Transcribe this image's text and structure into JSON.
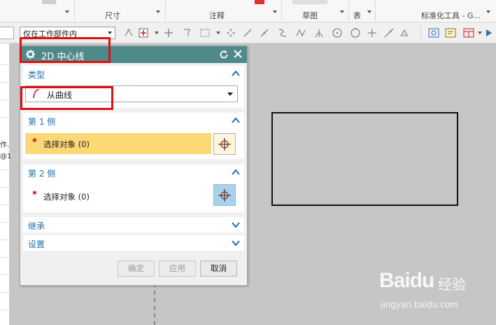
{
  "ribbon": {
    "groups": [
      {
        "label": "尺寸"
      },
      {
        "label": "注释"
      },
      {
        "label": "草图"
      },
      {
        "label": "表"
      },
      {
        "label": "标准化工具 - G..."
      }
    ]
  },
  "selection_bar": {
    "scope_value": "仅在工作部件内"
  },
  "navigator": {
    "fragments": [
      "作.",
      "@1"
    ]
  },
  "dialog": {
    "title": "2D 中心线",
    "sections": {
      "type": {
        "title": "类型",
        "combo_value": "从曲线"
      },
      "side1": {
        "title": "第 1 侧",
        "pick_label": "选择对象 (0)"
      },
      "side2": {
        "title": "第 2 侧",
        "pick_label": "选择对象 (0)"
      },
      "inherit": {
        "title": "继承"
      },
      "settings": {
        "title": "设置"
      }
    },
    "buttons": {
      "ok": "确定",
      "apply": "应用",
      "cancel": "取消"
    }
  },
  "watermark": {
    "logo": "Baidu",
    "product": "经验",
    "url": "jingyan.baidu.com"
  },
  "colors": {
    "title_bar": "#4f8a8b",
    "section_title": "#1f6fa7",
    "active_pick": "#fcd876",
    "highlight_box": "#e01010"
  }
}
